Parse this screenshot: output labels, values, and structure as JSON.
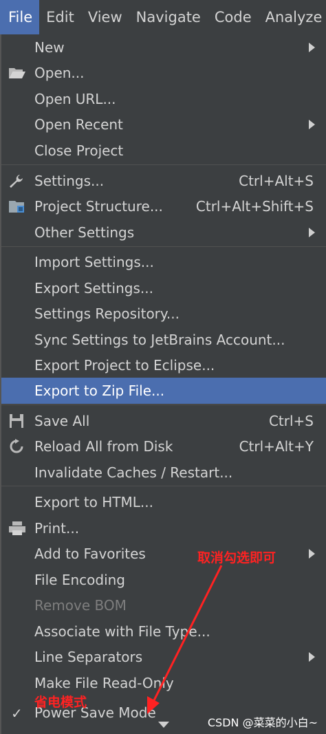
{
  "menubar": {
    "file": "File",
    "edit": "Edit",
    "view": "View",
    "navigate": "Navigate",
    "code": "Code",
    "analyze": "Analyze"
  },
  "menu": {
    "new": "New",
    "open": "Open...",
    "open_url": "Open URL...",
    "open_recent": "Open Recent",
    "close_project": "Close Project",
    "settings": "Settings...",
    "settings_shortcut": "Ctrl+Alt+S",
    "project_structure": "Project Structure...",
    "project_structure_shortcut": "Ctrl+Alt+Shift+S",
    "other_settings": "Other Settings",
    "import_settings": "Import Settings...",
    "export_settings": "Export Settings...",
    "settings_repository": "Settings Repository...",
    "sync_settings": "Sync Settings to JetBrains Account...",
    "export_project_eclipse": "Export Project to Eclipse...",
    "export_zip": "Export to Zip File...",
    "save_all": "Save All",
    "save_all_shortcut": "Ctrl+S",
    "reload_all": "Reload All from Disk",
    "reload_all_shortcut": "Ctrl+Alt+Y",
    "invalidate_caches": "Invalidate Caches / Restart...",
    "export_html": "Export to HTML...",
    "print": "Print...",
    "add_favorites": "Add to Favorites",
    "file_encoding": "File Encoding",
    "remove_bom": "Remove BOM",
    "associate_file_type": "Associate with File Type...",
    "line_separators": "Line Separators",
    "make_read_only": "Make File Read-Only",
    "power_save_mode": "Power Save Mode"
  },
  "annotations": {
    "uncheck_note": "取消勾选即可",
    "power_save_cn": "省电模式"
  },
  "watermark": "CSDN @菜菜的小白~",
  "colors": {
    "highlight": "#4b6eaf",
    "annotation": "#ff2222",
    "background": "#3c3f41"
  }
}
